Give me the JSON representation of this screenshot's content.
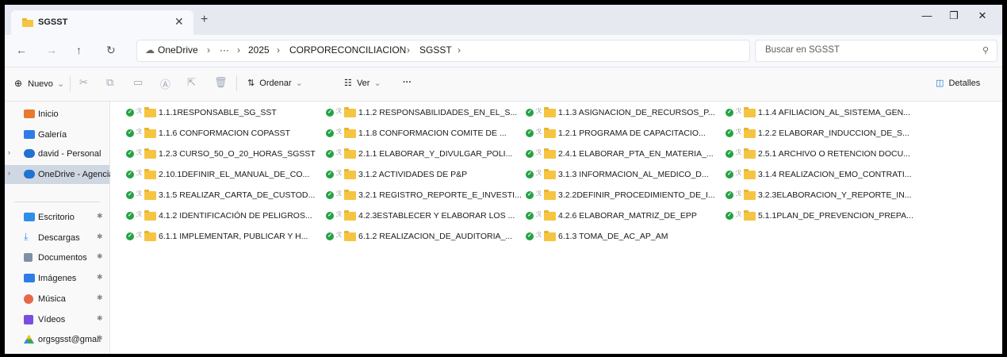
{
  "window": {
    "tab_title": "SGSST",
    "tab_close": "✕",
    "new_tab": "+",
    "minimize": "—",
    "maximize": "❐",
    "close": "✕"
  },
  "nav": {
    "back": "←",
    "forward": "→",
    "up": "↑",
    "refresh": "↻",
    "breadcrumb": [
      "OneDrive",
      "···",
      "2025",
      "CORPORECONCILIACION",
      "SGSST"
    ],
    "search_placeholder": "Buscar en SGSST"
  },
  "toolbar": {
    "new_label": "Nuevo",
    "sort_label": "Ordenar",
    "view_label": "Ver",
    "more_label": "···",
    "details_label": "Detalles"
  },
  "sidebar": {
    "items": [
      {
        "label": "Inicio",
        "icon": "home-icon",
        "color": "#e8792f"
      },
      {
        "label": "Galería",
        "icon": "gallery-icon",
        "color": "#2f7ce8"
      },
      {
        "label": "david - Personal",
        "icon": "cloud-icon",
        "color": "#1f73d1"
      },
      {
        "label": "OneDrive - Agencia",
        "icon": "cloud-icon",
        "color": "#1f73d1"
      }
    ],
    "quick": [
      {
        "label": "Escritorio",
        "icon": "desktop-icon",
        "color": "#2f8fe8"
      },
      {
        "label": "Descargas",
        "icon": "download-icon",
        "color": "#2f8fe8"
      },
      {
        "label": "Documentos",
        "icon": "documents-icon",
        "color": "#7f8fa6"
      },
      {
        "label": "Imágenes",
        "icon": "pictures-icon",
        "color": "#2f7ce8"
      },
      {
        "label": "Música",
        "icon": "music-icon",
        "color": "#e8674a"
      },
      {
        "label": "Vídeos",
        "icon": "videos-icon",
        "color": "#7a4fe0"
      },
      {
        "label": "orgsgsst@gmail",
        "icon": "drive-icon",
        "color": "#34a853"
      }
    ]
  },
  "files": [
    "1.1.1RESPONSABLE_SG_SST",
    "1.1.2 RESPONSABILIDADES_EN_EL_S...",
    "1.1.3 ASIGNACION_DE_RECURSOS_P...",
    "1.1.4 AFILIACION_AL_SISTEMA_GEN...",
    "1.1.6 CONFORMACION COPASST",
    "1.1.8 CONFORMACION COMITE DE ...",
    "1.2.1 PROGRAMA DE CAPACITACIO...",
    "1.2.2 ELABORAR_INDUCCION_DE_S...",
    "1.2.3 CURSO_50_O_20_HORAS_SGSST",
    "2.1.1 ELABORAR_Y_DIVULGAR_POLI...",
    "2.4.1 ELABORAR_PTA_EN_MATERIA_...",
    "2.5.1 ARCHIVO O RETENCION DOCU...",
    "2.10.1DEFINIR_EL_MANUAL_DE_CO...",
    "3.1.2 ACTIVIDADES DE P&P",
    "3.1.3 INFORMACION_AL_MEDICO_D...",
    "3.1.4 REALIZACION_EMO_CONTRATI...",
    "3.1.5 REALIZAR_CARTA_DE_CUSTOD...",
    "3.2.1 REGISTRO_REPORTE_E_INVESTI...",
    "3.2.2DEFINIR_PROCEDIMIENTO_DE_I...",
    "3.2.3ELABORACION_Y_REPORTE_IN...",
    "4.1.2 IDENTIFICACIÓN DE PELIGROS...",
    "4.2.3ESTABLECER Y ELABORAR LOS ...",
    "4.2.6 ELABORAR_MATRIZ_DE_EPP",
    "5.1.1PLAN_DE_PREVENCION_PREPA...",
    "6.1.1 IMPLEMENTAR, PUBLICAR Y H...",
    "6.1.2 REALIZACION_DE_AUDITORIA_...",
    "6.1.3 TOMA_DE_AC_AP_AM"
  ]
}
